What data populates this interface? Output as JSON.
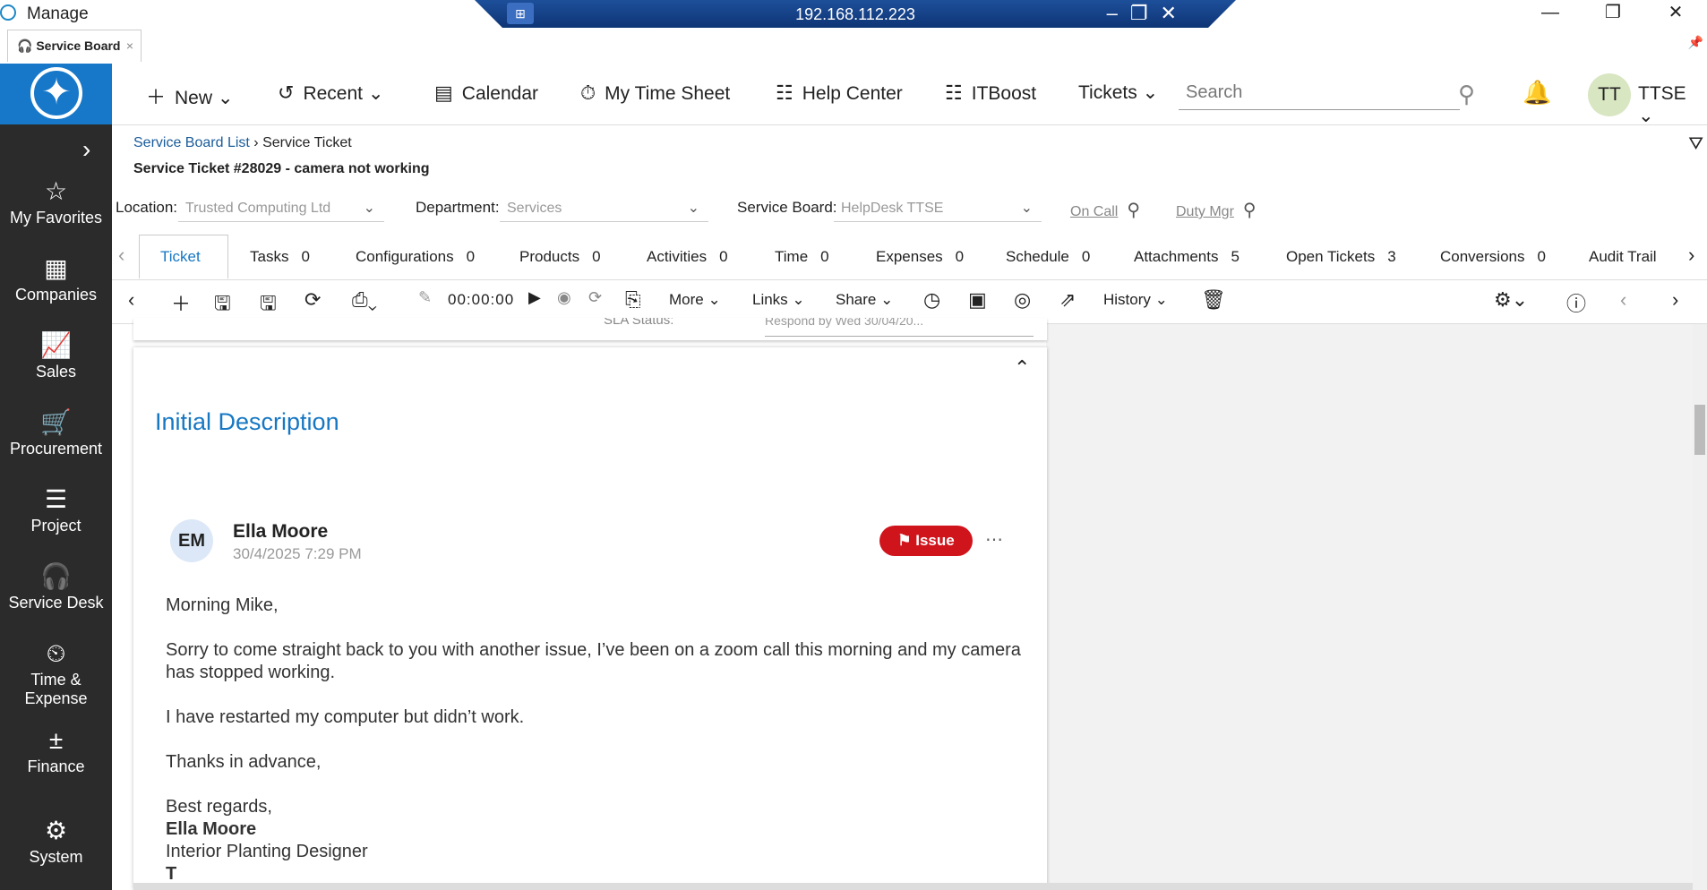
{
  "window": {
    "app_title": "Manage",
    "remote_ip": "192.168.112.223"
  },
  "tab": {
    "label": "Service Board",
    "close": "×"
  },
  "sidebar": {
    "items": [
      {
        "label": "My Favorites",
        "icon": "star-icon",
        "glyph": "☆"
      },
      {
        "label": "Companies",
        "icon": "building-icon",
        "glyph": "▦"
      },
      {
        "label": "Sales",
        "icon": "chart-icon",
        "glyph": "📈"
      },
      {
        "label": "Procurement",
        "icon": "cart-icon",
        "glyph": "🛒"
      },
      {
        "label": "Project",
        "icon": "project-icon",
        "glyph": "☰"
      },
      {
        "label": "Service Desk",
        "icon": "headset-icon",
        "glyph": "🎧"
      },
      {
        "label": "Time &\nExpense",
        "icon": "clock-icon",
        "glyph": "⏲"
      },
      {
        "label": "Finance",
        "icon": "calculator-icon",
        "glyph": "±"
      },
      {
        "label": "System",
        "icon": "gear-icon",
        "glyph": "⚙"
      }
    ]
  },
  "topnav": {
    "new": "New",
    "recent": "Recent",
    "calendar": "Calendar",
    "timesheet": "My Time Sheet",
    "help": "Help Center",
    "itboost": "ITBoost",
    "tickets": "Tickets",
    "search_placeholder": "Search",
    "user_initials": "TT",
    "user_name": "TTSE"
  },
  "breadcrumb": {
    "parent": "Service Board List",
    "current": "Service Ticket"
  },
  "page_title": "Service Ticket #28029 - camera not working",
  "fields": {
    "location_label": "Location:",
    "location_value": "Trusted Computing Ltd",
    "department_label": "Department:",
    "department_value": "Services",
    "board_label": "Service Board:",
    "board_value": "HelpDesk TTSE",
    "on_call": "On Call",
    "duty_mgr": "Duty Mgr"
  },
  "tabs": [
    {
      "label": "Ticket",
      "count": ""
    },
    {
      "label": "Tasks",
      "count": "0"
    },
    {
      "label": "Configurations",
      "count": "0"
    },
    {
      "label": "Products",
      "count": "0"
    },
    {
      "label": "Activities",
      "count": "0"
    },
    {
      "label": "Time",
      "count": "0"
    },
    {
      "label": "Expenses",
      "count": "0"
    },
    {
      "label": "Schedule",
      "count": "0"
    },
    {
      "label": "Attachments",
      "count": "5"
    },
    {
      "label": "Open Tickets",
      "count": "3"
    },
    {
      "label": "Conversions",
      "count": "0"
    },
    {
      "label": "Audit Trail",
      "count": ""
    }
  ],
  "toolbar": {
    "timer": "00:00:00",
    "more": "More",
    "links": "Links",
    "share": "Share",
    "history": "History"
  },
  "sla": {
    "label": "SLA Status:",
    "value": "Respond by Wed 30/04/20..."
  },
  "description": {
    "heading": "Initial Description",
    "initials": "EM",
    "author": "Ella Moore",
    "timestamp": "30/4/2025 7:29 PM",
    "badge": "Issue",
    "greeting": "Morning Mike,",
    "para1": "Sorry to come straight back to you with another issue, I’ve been on a zoom call this morning and my camera has stopped working.",
    "para2": "I have restarted my computer but didn’t work.",
    "para3": "Thanks in advance,",
    "closing": "Best regards,",
    "sig_name": "Ella Moore",
    "sig_title": "Interior Planting Designer",
    "sig_t": "T"
  }
}
